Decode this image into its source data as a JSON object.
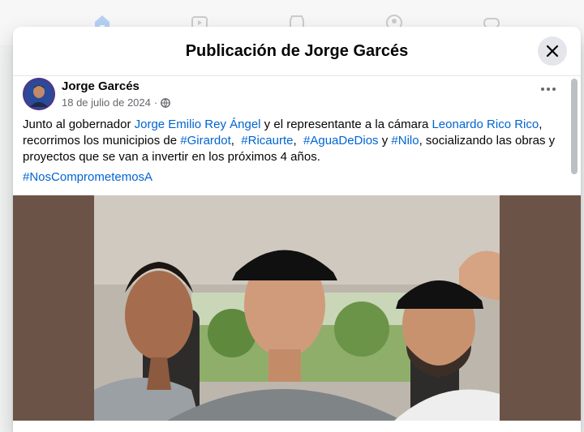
{
  "modal": {
    "title": "Publicación de Jorge Garcés",
    "close_label": "Cerrar"
  },
  "post": {
    "author": "Jorge Garcés",
    "date": "18 de julio de 2024",
    "date_separator": "·",
    "privacy_icon": "globe-icon",
    "more_icon": "more-horizontal-icon",
    "text": {
      "part1": "Junto al gobernador ",
      "mention1": "Jorge Emilio Rey Ángel",
      "part2": " y el representante a la cámara ",
      "mention2": "Leonardo Rico Rico",
      "part3": ", recorrimos los municipios de ",
      "hashtag1": "#Girardot",
      "sep1": ",  ",
      "hashtag2": "#Ricaurte",
      "sep2": ",  ",
      "hashtag3": "#AguaDeDios",
      "part4": " y ",
      "hashtag4": "#Nilo",
      "part5": ", socializando las obras y proyectos que se van a invertir en los próximos 4 años."
    },
    "hashtag_line": "#NosComprometemosA"
  },
  "colors": {
    "link": "#0064d1",
    "secondary_text": "#65676b",
    "photo_letterbox": "#6b5447"
  },
  "nav_icons": [
    "home-icon",
    "video-icon",
    "marketplace-icon",
    "groups-icon",
    "gaming-icon"
  ]
}
